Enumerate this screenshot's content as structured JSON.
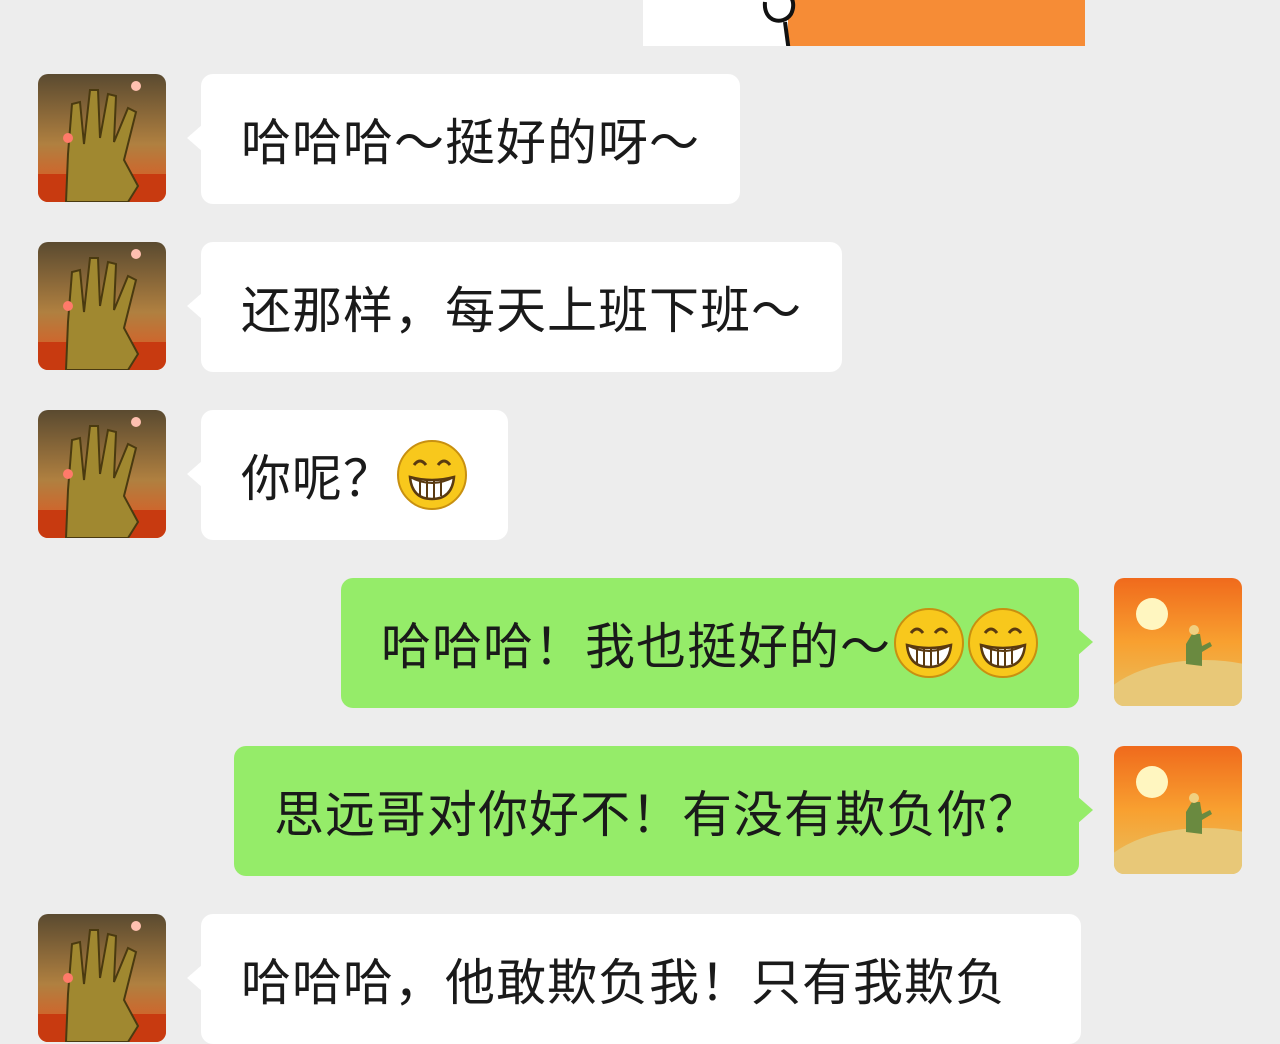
{
  "chat": {
    "top_image_label": "sticker-image",
    "messages": [
      {
        "side": "in",
        "text": "哈哈哈～挺好的呀～",
        "emojis": []
      },
      {
        "side": "in",
        "text": "还那样，每天上班下班～",
        "emojis": []
      },
      {
        "side": "in",
        "text": "你呢？",
        "emojis": [
          "grin-emoji"
        ]
      },
      {
        "side": "out",
        "text": "哈哈哈！我也挺好的～",
        "emojis": [
          "grin-emoji",
          "grin-emoji"
        ]
      },
      {
        "side": "out",
        "text": "思远哥对你好不！有没有欺负你？",
        "emojis": []
      },
      {
        "side": "in",
        "text": "哈哈哈，他敢欺负我！只有我欺负",
        "emojis": []
      }
    ]
  },
  "colors": {
    "background": "#ededed",
    "incoming_bubble": "#ffffff",
    "outgoing_bubble": "#95ec69",
    "sticker_orange": "#f68c36"
  }
}
